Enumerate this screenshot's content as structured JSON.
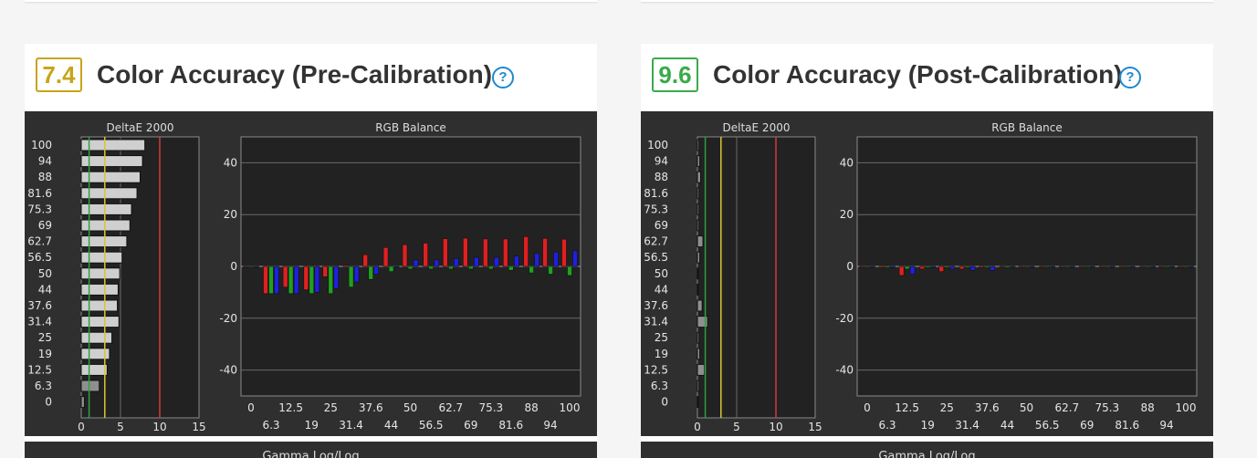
{
  "cards": [
    {
      "score": "7.4",
      "score_color": "#c9a418",
      "title": "Color Accuracy (Pre-Calibration)",
      "help_icon": "question-circle-icon",
      "lower_chart_title": "Gamma Log/Log",
      "chart_data": [
        {
          "type": "bar",
          "title": "DeltaE 2000",
          "orientation": "horizontal",
          "categories": [
            "100",
            "94",
            "88",
            "81.6",
            "75.3",
            "69",
            "62.7",
            "56.5",
            "50",
            "44",
            "37.6",
            "31.4",
            "25",
            "19",
            "12.5",
            "6.3",
            "0"
          ],
          "values": [
            8.1,
            7.8,
            7.5,
            7.1,
            6.4,
            6.2,
            5.8,
            5.2,
            4.9,
            4.7,
            4.6,
            4.8,
            3.9,
            3.6,
            3.3,
            2.3,
            0.4
          ],
          "xlim": [
            0,
            15
          ],
          "xticks": [
            "0",
            "5",
            "10",
            "15"
          ],
          "threshold_lines": [
            {
              "x": 1,
              "color": "#2ea043"
            },
            {
              "x": 3,
              "color": "#d4c832"
            },
            {
              "x": 10,
              "color": "#d43a3a"
            }
          ]
        },
        {
          "type": "bar",
          "title": "RGB Balance",
          "ylim": [
            -50,
            50
          ],
          "yticks": [
            "40",
            "20",
            "0",
            "-20",
            "-40"
          ],
          "xticks_top": [
            "0",
            "12.5",
            "25",
            "37.6",
            "50",
            "62.7",
            "75.3",
            "88",
            "100"
          ],
          "xticks_bottom": [
            "6.3",
            "19",
            "31.4",
            "44",
            "56.5",
            "69",
            "81.6",
            "94"
          ],
          "x": [
            0,
            6.3,
            12.5,
            19,
            25,
            31.4,
            37.6,
            44,
            50,
            56.5,
            62.7,
            69,
            75.3,
            81.6,
            88,
            94,
            100
          ],
          "series": [
            {
              "color": "#e02020",
              "values": [
                0,
                -10.5,
                -8,
                -9,
                -4,
                0.5,
                4.5,
                7.3,
                8.4,
                9,
                10.7,
                10.9,
                10.6,
                10.6,
                11.5,
                10.8,
                10.5
              ]
            },
            {
              "color": "#20a020",
              "values": [
                0,
                -10.5,
                -10.5,
                -10.5,
                -10.5,
                -8,
                -5,
                -2,
                -1,
                -1,
                -1,
                -1,
                -1,
                -1.5,
                -2.5,
                -3,
                -3.5
              ]
            },
            {
              "color": "#2020e0",
              "values": [
                0,
                -10.5,
                -10.5,
                -10,
                -8.5,
                -6,
                -3,
                0,
                2.5,
                2.5,
                3,
                3.5,
                3.5,
                4,
                5,
                5.5,
                6
              ]
            }
          ]
        }
      ]
    },
    {
      "score": "9.6",
      "score_color": "#3aaa4a",
      "title": "Color Accuracy (Post-Calibration)",
      "help_icon": "question-circle-icon",
      "lower_chart_title": "Gamma Log/Log",
      "chart_data": [
        {
          "type": "bar",
          "title": "DeltaE 2000",
          "orientation": "horizontal",
          "categories": [
            "100",
            "94",
            "88",
            "81.6",
            "75.3",
            "69",
            "62.7",
            "56.5",
            "50",
            "44",
            "37.6",
            "31.4",
            "25",
            "19",
            "12.5",
            "6.3",
            "0"
          ],
          "values": [
            0.2,
            0.3,
            0.4,
            0.2,
            0.2,
            0.2,
            0.7,
            0.3,
            0.1,
            0.1,
            0.6,
            1.3,
            0.2,
            0.3,
            0.9,
            0.2,
            0.1
          ],
          "xlim": [
            0,
            15
          ],
          "xticks": [
            "0",
            "5",
            "10",
            "15"
          ],
          "threshold_lines": [
            {
              "x": 1,
              "color": "#2ea043"
            },
            {
              "x": 3,
              "color": "#d4c832"
            },
            {
              "x": 10,
              "color": "#d43a3a"
            }
          ]
        },
        {
          "type": "bar",
          "title": "RGB Balance",
          "ylim": [
            -50,
            50
          ],
          "yticks": [
            "40",
            "20",
            "0",
            "-20",
            "-40"
          ],
          "xticks_top": [
            "0",
            "12.5",
            "25",
            "37.6",
            "50",
            "62.7",
            "75.3",
            "88",
            "100"
          ],
          "xticks_bottom": [
            "6.3",
            "19",
            "31.4",
            "44",
            "56.5",
            "69",
            "81.6",
            "94"
          ],
          "x": [
            0,
            6.3,
            12.5,
            19,
            25,
            31.4,
            37.6,
            44,
            50,
            56.5,
            62.7,
            69,
            75.3,
            81.6,
            88,
            94,
            100
          ],
          "series": [
            {
              "color": "#e02020",
              "values": [
                0,
                -0.5,
                -3.5,
                -1,
                -2,
                -1,
                -0.5,
                0,
                0,
                0,
                0,
                0,
                0,
                0,
                0,
                0,
                0
              ]
            },
            {
              "color": "#20a020",
              "values": [
                0,
                -0.5,
                -1,
                -0.5,
                -0.5,
                -0.5,
                -0.5,
                -0.5,
                0,
                0,
                0,
                0,
                0,
                0,
                0,
                0,
                0
              ]
            },
            {
              "color": "#2020e0",
              "values": [
                0,
                -0.5,
                -3,
                -0.5,
                -1,
                -1.5,
                -1.5,
                0,
                0,
                0,
                0,
                0,
                0,
                0,
                0,
                0,
                0
              ]
            }
          ]
        }
      ]
    }
  ]
}
